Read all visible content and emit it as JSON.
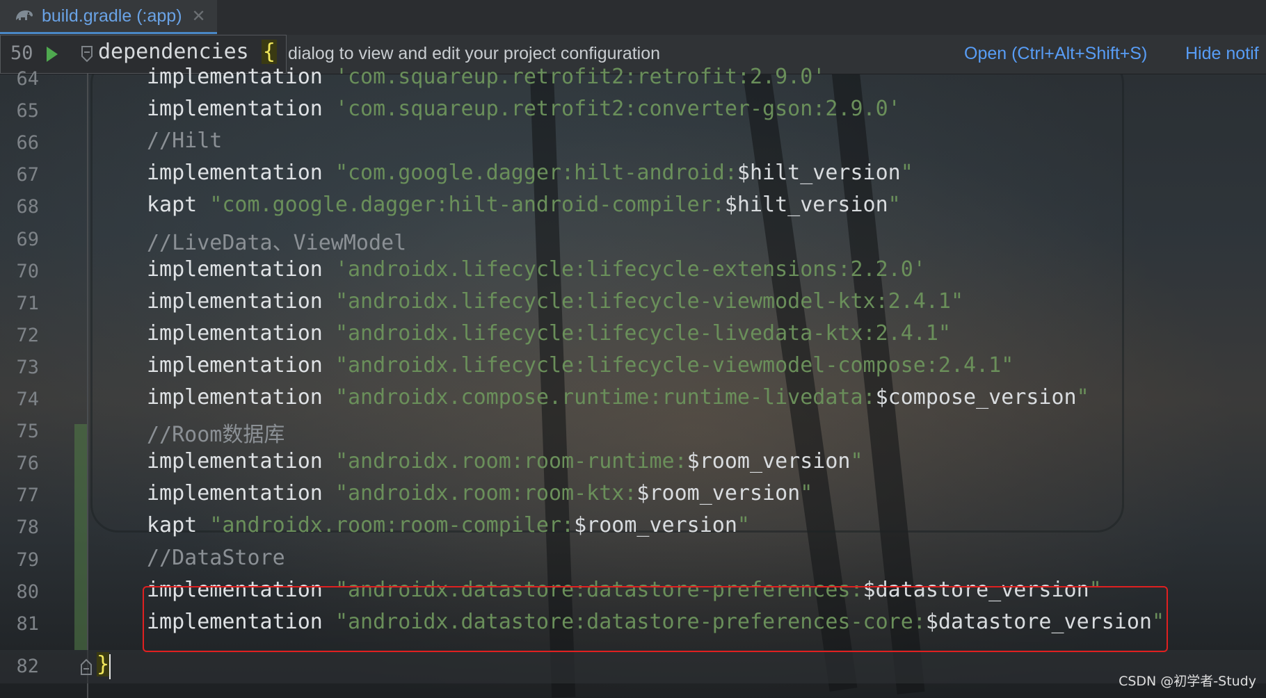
{
  "tab": {
    "label": "build.gradle (:app)",
    "icon": "gradle-elephant-icon",
    "close": "✕"
  },
  "banner": {
    "text": "dialog to view and edit your project configuration",
    "open_link": "Open (Ctrl+Alt+Shift+S)",
    "hide_link": "Hide notif"
  },
  "sticky": {
    "line_number": "50",
    "code": "dependencies ",
    "brace": "{"
  },
  "lines": [
    {
      "n": "64",
      "kw": "implementation ",
      "str": "'com.squareup.retrofit2:retrofit:2.9.0'",
      "var": "",
      "end": ""
    },
    {
      "n": "65",
      "kw": "implementation ",
      "str": "'com.squareup.retrofit2:converter-gson:2.9.0'",
      "var": "",
      "end": ""
    },
    {
      "n": "66",
      "cmt": "//Hilt"
    },
    {
      "n": "67",
      "kw": "implementation ",
      "str": "\"com.google.dagger:hilt-android:",
      "var": "$hilt_version",
      "end": "\""
    },
    {
      "n": "68",
      "kw": "kapt ",
      "str": "\"com.google.dagger:hilt-android-compiler:",
      "var": "$hilt_version",
      "end": "\""
    },
    {
      "n": "69",
      "cmt": "//LiveData、ViewModel"
    },
    {
      "n": "70",
      "kw": "implementation ",
      "str": "'androidx.lifecycle:lifecycle-extensions:2.2.0'",
      "var": "",
      "end": ""
    },
    {
      "n": "71",
      "kw": "implementation ",
      "str": "\"androidx.lifecycle:lifecycle-viewmodel-ktx:2.4.1\"",
      "var": "",
      "end": ""
    },
    {
      "n": "72",
      "kw": "implementation ",
      "str": "\"androidx.lifecycle:lifecycle-livedata-ktx:2.4.1\"",
      "var": "",
      "end": ""
    },
    {
      "n": "73",
      "kw": "implementation ",
      "str": "\"androidx.lifecycle:lifecycle-viewmodel-compose:2.4.1\"",
      "var": "",
      "end": ""
    },
    {
      "n": "74",
      "kw": "implementation ",
      "str": "\"androidx.compose.runtime:runtime-livedata:",
      "var": "$compose_version",
      "end": "\""
    },
    {
      "n": "75",
      "cmt": "//Room数据库"
    },
    {
      "n": "76",
      "kw": "implementation ",
      "str": "\"androidx.room:room-runtime:",
      "var": "$room_version",
      "end": "\""
    },
    {
      "n": "77",
      "kw": "implementation ",
      "str": "\"androidx.room:room-ktx:",
      "var": "$room_version",
      "end": "\""
    },
    {
      "n": "78",
      "kw": "kapt ",
      "str": "\"androidx.room:room-compiler:",
      "var": "$room_version",
      "end": "\""
    },
    {
      "n": "79",
      "cmt": "//DataStore"
    },
    {
      "n": "80",
      "kw": "implementation ",
      "str": "\"androidx.datastore:datastore-preferences:",
      "var": "$datastore_version",
      "end": "\""
    },
    {
      "n": "81",
      "kw": "implementation ",
      "str": "\"androidx.datastore:datastore-preferences-core:",
      "var": "$datastore_version",
      "end": "\""
    }
  ],
  "last_line": {
    "n": "82",
    "brace": "}"
  },
  "watermark": "CSDN @初学者-Study",
  "colors": {
    "string": "#6a8f5a",
    "link": "#589df6",
    "highlight_box": "#e02020",
    "brace_match": "#f2e85c"
  }
}
